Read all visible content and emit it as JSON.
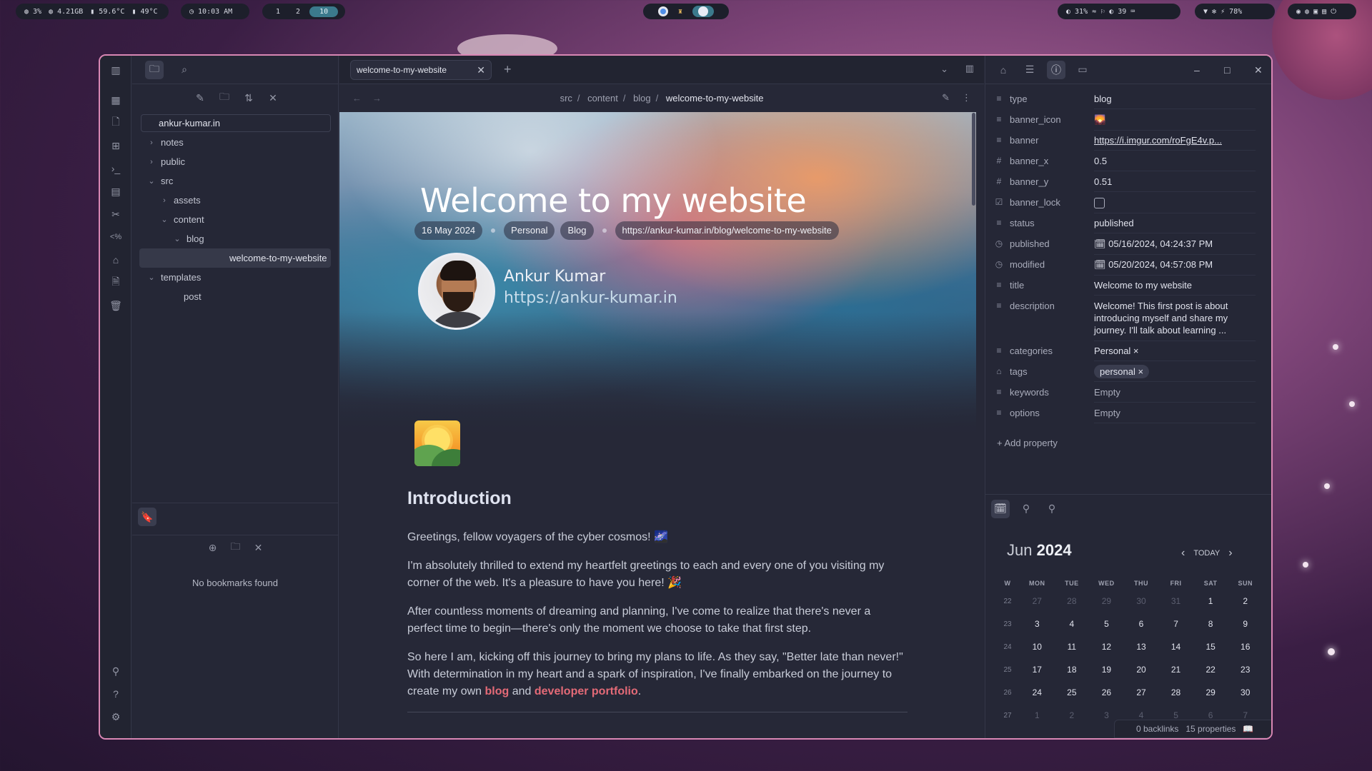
{
  "topbar": {
    "stats": [
      "◍ 3%",
      "◍ 4.21GB",
      "▮ 59.6°C",
      "▮ 49°C"
    ],
    "clock": "◷ 10:03 AM",
    "workspaces": [
      "1",
      "2",
      "10"
    ],
    "active_workspace": "10",
    "right_stats": "◐ 31%  ≈  ⚐  ◐ 39  ⌨",
    "battery": "▼  ✻  ⚡ 78%"
  },
  "ribbon": {
    "icons": [
      "layout-icon",
      "files-icon",
      "graph-icon",
      "terminal-icon",
      "table-icon",
      "tools-icon",
      "code-icon",
      "home-icon",
      "new-file-icon",
      "trash-icon",
      "vault-icon",
      "help-icon",
      "settings-icon"
    ]
  },
  "explorer": {
    "vault_name": "ankur-kumar.in",
    "items": [
      {
        "label": "notes",
        "indent": 0,
        "type": "folder",
        "open": false
      },
      {
        "label": "public",
        "indent": 0,
        "type": "folder",
        "open": false
      },
      {
        "label": "src",
        "indent": 0,
        "type": "folder",
        "open": true
      },
      {
        "label": "assets",
        "indent": 1,
        "type": "folder",
        "open": false
      },
      {
        "label": "content",
        "indent": 1,
        "type": "folder",
        "open": true
      },
      {
        "label": "blog",
        "indent": 2,
        "type": "folder",
        "open": true
      },
      {
        "label": "welcome-to-my-website",
        "indent": 3,
        "type": "file",
        "selected": true
      },
      {
        "label": "templates",
        "indent": 0,
        "type": "folder",
        "open": true
      },
      {
        "label": "post",
        "indent": 1,
        "type": "file"
      }
    ]
  },
  "bookmarks": {
    "empty_text": "No bookmarks found"
  },
  "tab": {
    "title": "welcome-to-my-website"
  },
  "breadcrumb": [
    "src",
    "content",
    "blog",
    "welcome-to-my-website"
  ],
  "post": {
    "title": "Welcome to my website",
    "date": "16 May 2024",
    "category": "Personal",
    "type": "Blog",
    "url": "https://ankur-kumar.in/blog/welcome-to-my-website",
    "author_name": "Ankur Kumar",
    "author_url": "https://ankur-kumar.in",
    "heading": "Introduction",
    "p1": "Greetings, fellow voyagers of the cyber cosmos! 🌌",
    "p2": "I'm absolutely thrilled to extend my heartfelt greetings to each and every one of you visiting my corner of the web. It's a pleasure to have you here! 🎉",
    "p3": "After countless moments of dreaming and planning, I've come to realize that there's never a perfect time to begin—there's only the moment we choose to take that first step.",
    "p4_pre": "So here I am, kicking off this journey to bring my plans to life. As they say, \"Better late than never!\" With determination in my heart and a spark of inspiration, I've finally embarked on the journey to create my own",
    "p4_link1": "blog",
    "p4_mid": "and",
    "p4_link2": "developer portfolio",
    "p4_end": "."
  },
  "properties": [
    {
      "icon": "≡",
      "key": "type",
      "value": "blog"
    },
    {
      "icon": "≡",
      "key": "banner_icon",
      "value": "🌄"
    },
    {
      "icon": "≡",
      "key": "banner",
      "value": "https://i.imgur.com/roFgE4v.p...",
      "link": true
    },
    {
      "icon": "#",
      "key": "banner_x",
      "value": "0.5"
    },
    {
      "icon": "#",
      "key": "banner_y",
      "value": "0.51"
    },
    {
      "icon": "☑",
      "key": "banner_lock",
      "value": "",
      "checkbox": true
    },
    {
      "icon": "≡",
      "key": "status",
      "value": "published"
    },
    {
      "icon": "◷",
      "key": "published",
      "value": "🗓 05/16/2024, 04:24:37 PM"
    },
    {
      "icon": "◷",
      "key": "modified",
      "value": "🗓 05/20/2024, 04:57:08 PM"
    },
    {
      "icon": "≡",
      "key": "title",
      "value": "Welcome to my website"
    },
    {
      "icon": "≡",
      "key": "description",
      "value": "Welcome! This first post is about introducing myself and share my journey. I'll talk about  learning ..."
    },
    {
      "icon": "≡",
      "key": "categories",
      "value": "Personal ×"
    },
    {
      "icon": "⌂",
      "key": "tags",
      "value": "personal ×",
      "pill": true
    },
    {
      "icon": "≡",
      "key": "keywords",
      "value": "Empty",
      "muted": true
    },
    {
      "icon": "≡",
      "key": "options",
      "value": "Empty",
      "muted": true
    }
  ],
  "add_property": "+ Add property",
  "calendar": {
    "month": "Jun",
    "year": "2024",
    "today_label": "TODAY",
    "weekday_headers": [
      "W",
      "MON",
      "TUE",
      "WED",
      "THU",
      "FRI",
      "SAT",
      "SUN"
    ],
    "weeks": [
      {
        "w": "22",
        "days": [
          "27",
          "28",
          "29",
          "30",
          "31",
          "1",
          "2"
        ],
        "other": [
          true,
          true,
          true,
          true,
          true,
          false,
          false
        ]
      },
      {
        "w": "23",
        "days": [
          "3",
          "4",
          "5",
          "6",
          "7",
          "8",
          "9"
        ],
        "other": [
          false,
          false,
          false,
          false,
          false,
          false,
          false
        ]
      },
      {
        "w": "24",
        "days": [
          "10",
          "11",
          "12",
          "13",
          "14",
          "15",
          "16"
        ],
        "other": [
          false,
          false,
          false,
          false,
          false,
          false,
          false
        ]
      },
      {
        "w": "25",
        "days": [
          "17",
          "18",
          "19",
          "20",
          "21",
          "22",
          "23"
        ],
        "other": [
          false,
          false,
          false,
          false,
          false,
          false,
          false
        ]
      },
      {
        "w": "26",
        "days": [
          "24",
          "25",
          "26",
          "27",
          "28",
          "29",
          "30"
        ],
        "other": [
          false,
          false,
          false,
          false,
          false,
          false,
          false
        ]
      },
      {
        "w": "27",
        "days": [
          "1",
          "2",
          "3",
          "4",
          "5",
          "6",
          "7"
        ],
        "other": [
          true,
          true,
          true,
          true,
          true,
          true,
          true
        ]
      }
    ]
  },
  "status": {
    "backlinks": "0 backlinks",
    "properties": "15 properties"
  }
}
